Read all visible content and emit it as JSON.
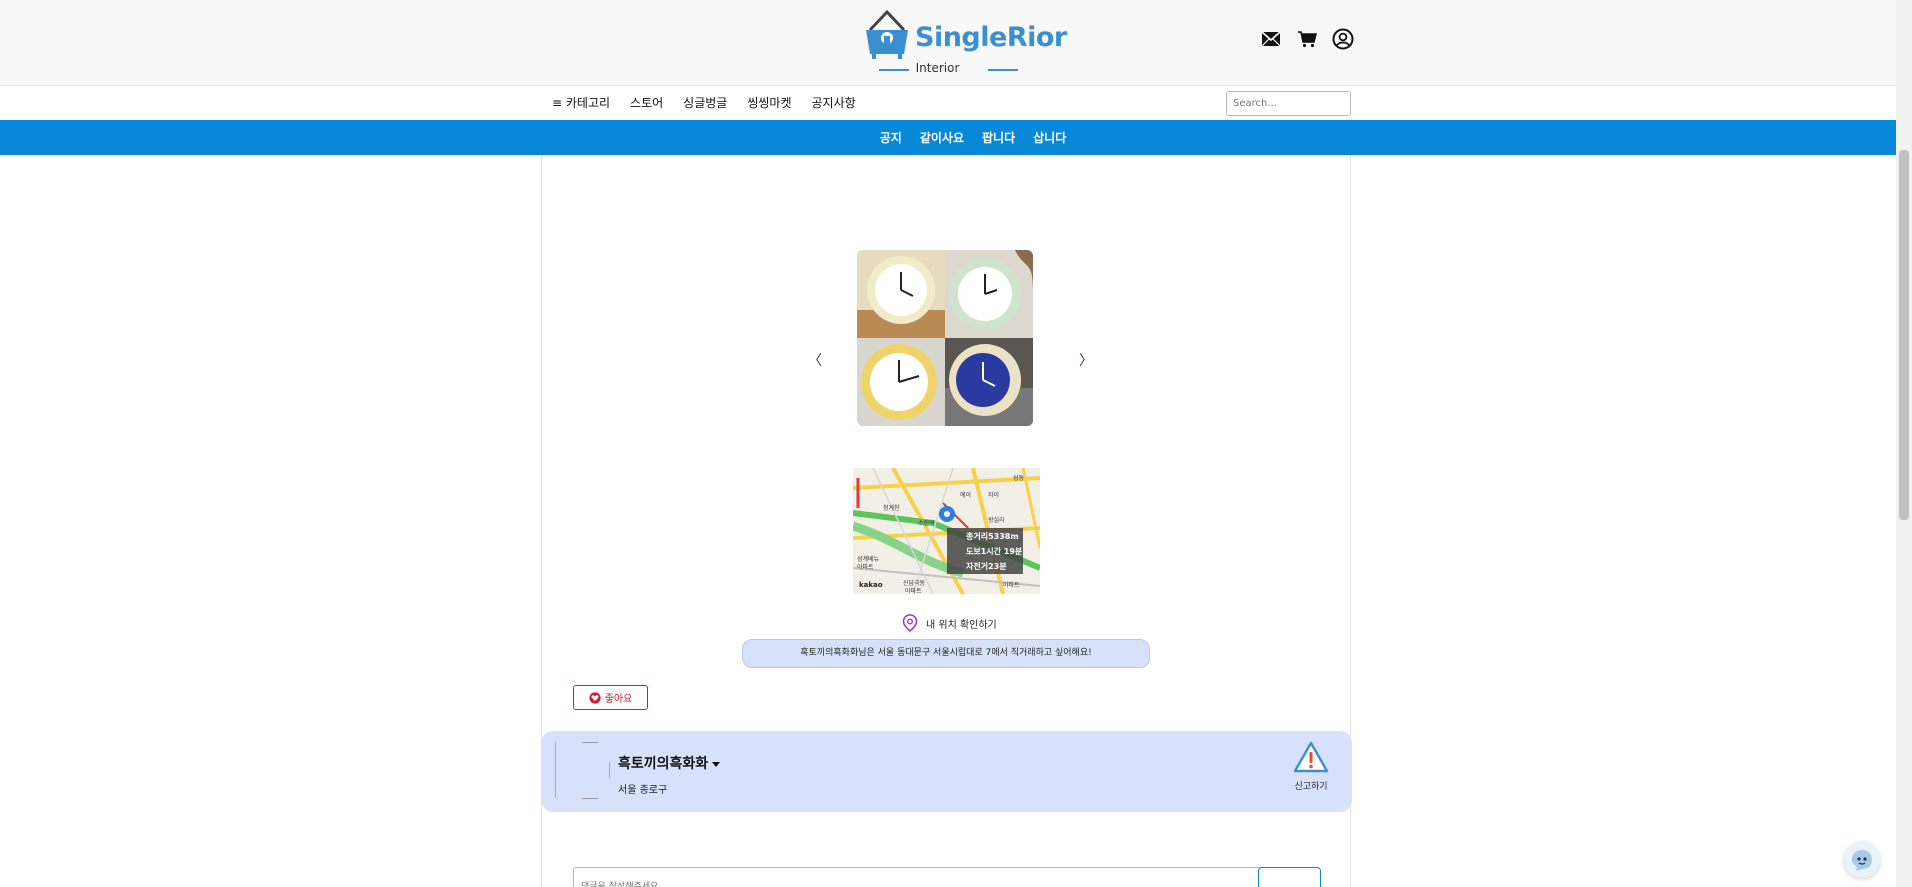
{
  "header": {
    "logo_text": "SingleRior",
    "logo_sub": "Interior",
    "brand_color": "#3a8fd0",
    "icons": [
      "mail-icon",
      "cart-icon",
      "user-icon"
    ]
  },
  "nav": {
    "category_label": "≡ 카테고리",
    "items": [
      "스토어",
      "싱글벙글",
      "씽씽마켓",
      "공지사항"
    ],
    "search_placeholder": "Search..."
  },
  "subnav": {
    "color": "#0a88d8",
    "items": [
      "공지",
      "같이사요",
      "팝니다",
      "삽니다"
    ]
  },
  "post": {
    "carousel_prev": "〈",
    "carousel_next": "〉",
    "map": {
      "distance": "총거리5338m",
      "walk_time": "도보1시간 19분",
      "bike_time": "자전거23분",
      "provider": "kakao",
      "labels": [
        "에이",
        "소진여",
        "왕십리",
        "성동",
        "청계천",
        "자이",
        "성계베뉴",
        "아파트",
        "신답극동",
        "아파트",
        "아파트"
      ]
    },
    "locate_label": "내 위치 확인하기",
    "address_text": "흑토끼의흑화화님은 서울 동대문구 서울시립대로 7에서 직거래하고 싶어해요!",
    "like_label": "좋아요"
  },
  "seller": {
    "name": "흑토끼의흑화화",
    "location": "서울 종로구",
    "report_label": "신고하기"
  },
  "comment": {
    "placeholder": "댓글을 작성해주세요."
  }
}
